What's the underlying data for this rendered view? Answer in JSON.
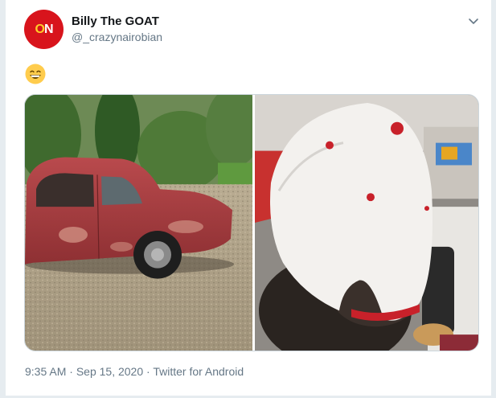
{
  "tweet": {
    "display_name": "Billy The GOAT",
    "handle": "@_crazynairobian",
    "avatar": {
      "logo_left": "O",
      "logo_right": "N",
      "tagline": "",
      "bg": "#d8141c",
      "accent": "#ffcc29"
    },
    "body_emoji": "grinning-face-with-smiling-eyes",
    "media": [
      {
        "alt": "red-vintage-car-photo"
      },
      {
        "alt": "white-cap-with-red-dots-photo"
      }
    ],
    "time": "9:35 AM",
    "date": "Sep 15, 2020",
    "source": "Twitter for Android",
    "separator": "·"
  },
  "icons": {
    "menu": "chevron-down-icon"
  },
  "colors": {
    "text_primary": "#14171a",
    "text_secondary": "#657786",
    "border": "#ccd6dd"
  }
}
